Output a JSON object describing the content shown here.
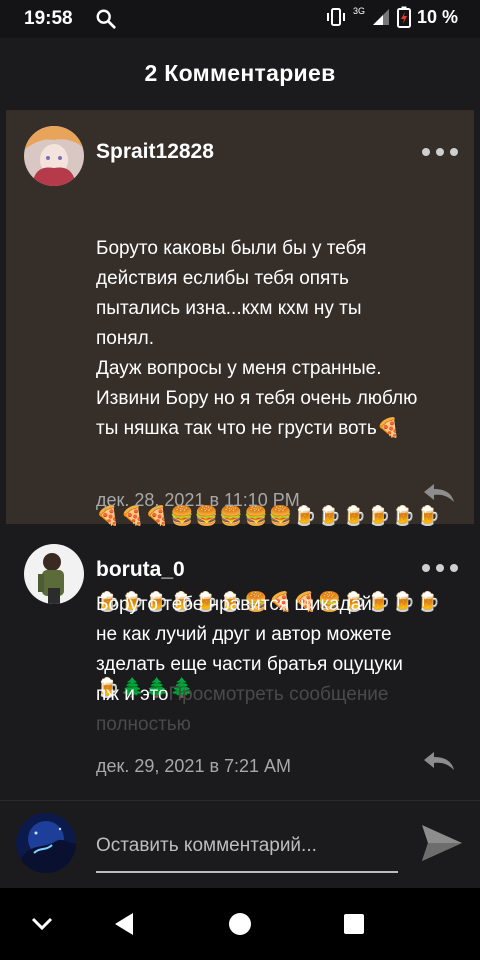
{
  "status_bar": {
    "time": "19:58",
    "network": "3G",
    "battery": "10 %",
    "icons": [
      "search-icon",
      "vibrate-icon",
      "signal-icon",
      "battery-charging-icon"
    ]
  },
  "header": {
    "title": "2 Комментариев"
  },
  "comments": [
    {
      "username": "Sprait12828",
      "text": "Боруто каковы были бы у тебя\nдействия еслибы тебя опять\nпытались изна...кхм кхм ну ты\nпонял.\nДауж вопросы у меня странные.\nИзвини Бору но я тебя очень люблю\nты няшка так что не грусти воть🍕",
      "emoji_line_1": "🍕🍕🍕🍔🍔🍔🍔🍔🍺🍺🍺🍺🍺🍺",
      "emoji_line_2": "🍺🍺🍺🍺🍺🍺🍔🍕🍕🍔🍺🍺🍺🍺",
      "emoji_line_3": "🍺🌲🌲🌲",
      "date": "дек. 28, 2021 в 11:10 PM",
      "highlighted": true
    },
    {
      "username": "boruta_0",
      "text": "Боруто тебе нравится шикадай\nне как лучий друг и автор можете\nзделать еще части братья оцуцуки\nпж и это",
      "see_more": "Просмотреть сообщение\nполностью",
      "date": "дек. 29, 2021 в 7:21 AM",
      "highlighted": false
    }
  ],
  "compose": {
    "placeholder": "Оставить комментарий..."
  },
  "colors": {
    "background": "#1b1a1c",
    "highlight": "#352e29",
    "date": "#a8a8a8"
  },
  "nav_bar": {
    "icons": [
      "chevron-down-icon",
      "back-icon",
      "home-icon",
      "recents-icon"
    ]
  }
}
